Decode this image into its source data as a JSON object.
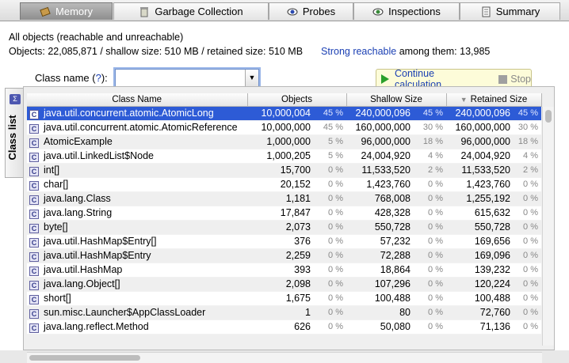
{
  "tabs": [
    {
      "label": "Memory",
      "icon": "memory-icon",
      "active": true
    },
    {
      "label": "Garbage Collection",
      "icon": "trash-icon",
      "active": false
    },
    {
      "label": "Probes",
      "icon": "eye-icon",
      "active": false
    },
    {
      "label": "Inspections",
      "icon": "eye-icon",
      "active": false
    },
    {
      "label": "Summary",
      "icon": "document-icon",
      "active": false
    }
  ],
  "header": {
    "title": "All objects (reachable and unreachable)",
    "stats": "Objects: 22,085,871 / shallow size: 510 MB / retained size: 510 MB",
    "strong_link": "Strong reachable",
    "strong_rest": " among them: 13,985"
  },
  "side_tab": {
    "label": "Class list"
  },
  "filter": {
    "label_prefix": "Class name (",
    "help": "?",
    "label_suffix": "):",
    "value": ""
  },
  "calc": {
    "continue_label": "Continue calculation",
    "stop_label": "Stop"
  },
  "table": {
    "columns": [
      "Class Name",
      "Objects",
      "Shallow Size",
      "Retained Size"
    ],
    "sorted_column": "Retained Size",
    "rows": [
      {
        "name": "java.util.concurrent.atomic.AtomicLong",
        "objects": "10,000,004",
        "obj_pct": "45 %",
        "shallow": "240,000,096",
        "sh_pct": "45 %",
        "retained": "240,000,096",
        "ret_pct": "45 %",
        "selected": true
      },
      {
        "name": "java.util.concurrent.atomic.AtomicReference",
        "objects": "10,000,000",
        "obj_pct": "45 %",
        "shallow": "160,000,000",
        "sh_pct": "30 %",
        "retained": "160,000,000",
        "ret_pct": "30 %"
      },
      {
        "name": "AtomicExample",
        "objects": "1,000,000",
        "obj_pct": "5 %",
        "shallow": "96,000,000",
        "sh_pct": "18 %",
        "retained": "96,000,000",
        "ret_pct": "18 %"
      },
      {
        "name": "java.util.LinkedList$Node",
        "objects": "1,000,205",
        "obj_pct": "5 %",
        "shallow": "24,004,920",
        "sh_pct": "4 %",
        "retained": "24,004,920",
        "ret_pct": "4 %"
      },
      {
        "name": "int[]",
        "objects": "15,700",
        "obj_pct": "0 %",
        "shallow": "11,533,520",
        "sh_pct": "2 %",
        "retained": "11,533,520",
        "ret_pct": "2 %"
      },
      {
        "name": "char[]",
        "objects": "20,152",
        "obj_pct": "0 %",
        "shallow": "1,423,760",
        "sh_pct": "0 %",
        "retained": "1,423,760",
        "ret_pct": "0 %"
      },
      {
        "name": "java.lang.Class",
        "objects": "1,181",
        "obj_pct": "0 %",
        "shallow": "768,008",
        "sh_pct": "0 %",
        "retained": "1,255,192",
        "ret_pct": "0 %"
      },
      {
        "name": "java.lang.String",
        "objects": "17,847",
        "obj_pct": "0 %",
        "shallow": "428,328",
        "sh_pct": "0 %",
        "retained": "615,632",
        "ret_pct": "0 %"
      },
      {
        "name": "byte[]",
        "objects": "2,073",
        "obj_pct": "0 %",
        "shallow": "550,728",
        "sh_pct": "0 %",
        "retained": "550,728",
        "ret_pct": "0 %"
      },
      {
        "name": "java.util.HashMap$Entry[]",
        "objects": "376",
        "obj_pct": "0 %",
        "shallow": "57,232",
        "sh_pct": "0 %",
        "retained": "169,656",
        "ret_pct": "0 %"
      },
      {
        "name": "java.util.HashMap$Entry",
        "objects": "2,259",
        "obj_pct": "0 %",
        "shallow": "72,288",
        "sh_pct": "0 %",
        "retained": "169,096",
        "ret_pct": "0 %"
      },
      {
        "name": "java.util.HashMap",
        "objects": "393",
        "obj_pct": "0 %",
        "shallow": "18,864",
        "sh_pct": "0 %",
        "retained": "139,232",
        "ret_pct": "0 %"
      },
      {
        "name": "java.lang.Object[]",
        "objects": "2,098",
        "obj_pct": "0 %",
        "shallow": "107,296",
        "sh_pct": "0 %",
        "retained": "120,224",
        "ret_pct": "0 %"
      },
      {
        "name": "short[]",
        "objects": "1,675",
        "obj_pct": "0 %",
        "shallow": "100,488",
        "sh_pct": "0 %",
        "retained": "100,488",
        "ret_pct": "0 %"
      },
      {
        "name": "sun.misc.Launcher$AppClassLoader",
        "objects": "1",
        "obj_pct": "0 %",
        "shallow": "80",
        "sh_pct": "0 %",
        "retained": "72,760",
        "ret_pct": "0 %"
      },
      {
        "name": "java.lang.reflect.Method",
        "objects": "626",
        "obj_pct": "0 %",
        "shallow": "50,080",
        "sh_pct": "0 %",
        "retained": "71,136",
        "ret_pct": "0 %"
      }
    ]
  }
}
